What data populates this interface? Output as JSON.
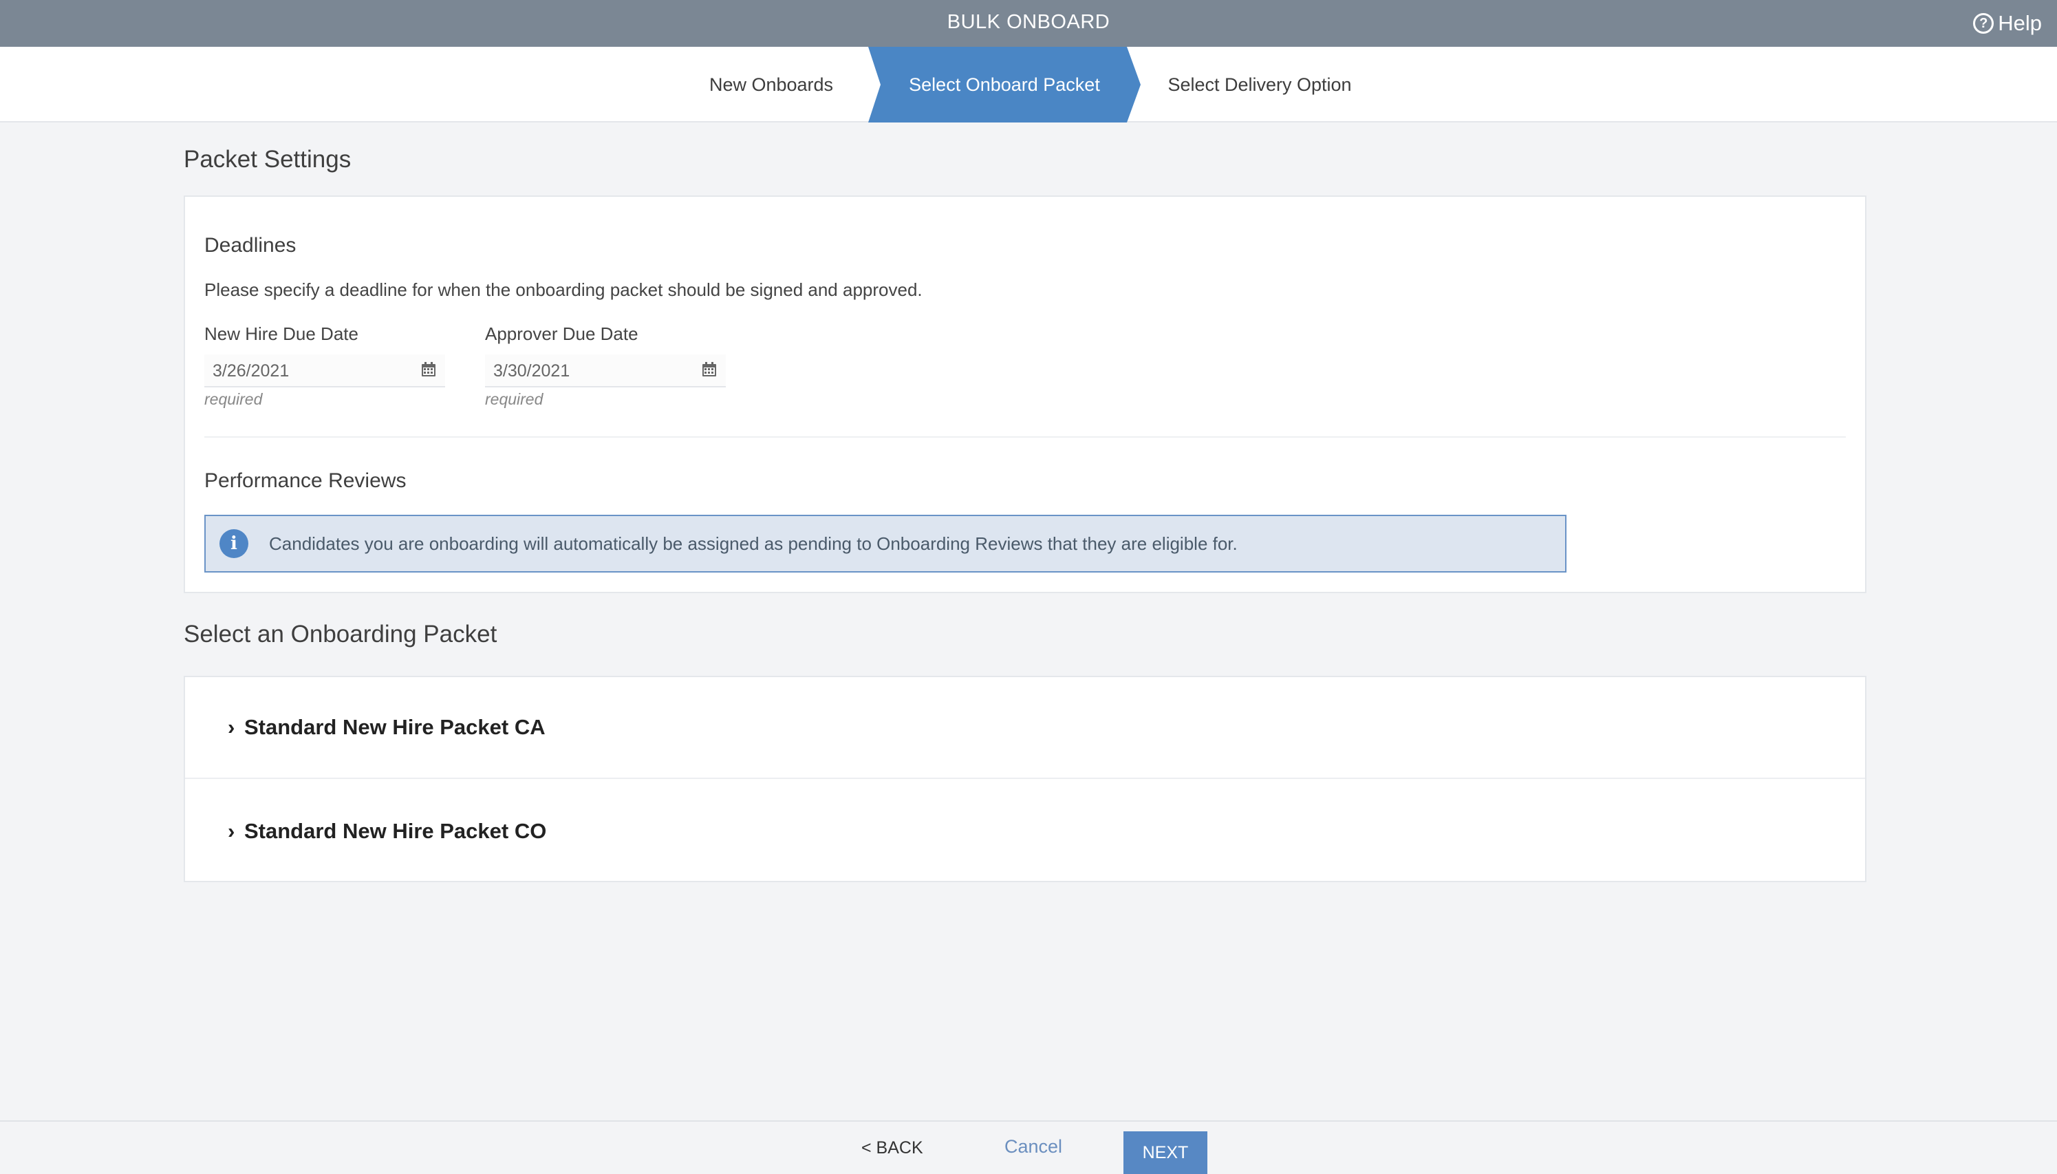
{
  "header": {
    "title": "BULK ONBOARD",
    "help_label": "Help",
    "help_icon": "help-circle-icon"
  },
  "stepper": {
    "steps": [
      {
        "label": "New Onboards",
        "active": false
      },
      {
        "label": "Select Onboard Packet",
        "active": true
      },
      {
        "label": "Select Delivery Option",
        "active": false
      }
    ],
    "active_color": "#4a86c5"
  },
  "packet_settings": {
    "heading": "Packet Settings",
    "deadlines": {
      "heading": "Deadlines",
      "description": "Please specify a deadline for when the onboarding packet should be signed and approved.",
      "new_hire_due": {
        "label": "New Hire Due Date",
        "value": "3/26/2021",
        "hint": "required"
      },
      "approver_due": {
        "label": "Approver Due Date",
        "value": "3/30/2021",
        "hint": "required"
      }
    },
    "performance_reviews": {
      "heading": "Performance Reviews",
      "info": "Candidates you are onboarding will automatically be assigned as pending to Onboarding Reviews that they are eligible for."
    }
  },
  "packets": {
    "heading": "Select an Onboarding Packet",
    "items": [
      {
        "label": "Standard New Hire Packet CA"
      },
      {
        "label": "Standard New Hire Packet CO"
      }
    ]
  },
  "footer": {
    "back_label": "< BACK",
    "cancel_label": "Cancel",
    "next_label": "NEXT"
  }
}
